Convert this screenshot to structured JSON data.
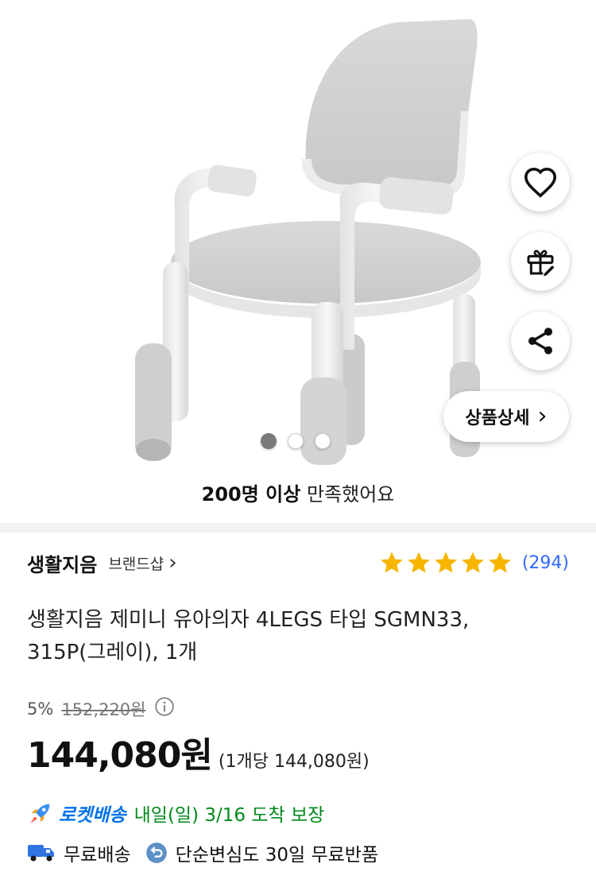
{
  "gallery": {
    "image_alt": "gray kids chair with four legs and armrests",
    "dots": 3,
    "active_dot": 0
  },
  "actions": {
    "like_icon": "heart-icon",
    "gift_icon": "gift-icon",
    "share_icon": "share-icon",
    "detail_label": "상품상세",
    "detail_chevron": "›"
  },
  "satisfaction": {
    "bold": "200명 이상",
    "rest": "만족했어요"
  },
  "brand": {
    "name": "생활지음",
    "shop_label": "브랜드샵",
    "chevron": "›"
  },
  "rating": {
    "stars": 5,
    "value": 5,
    "count": "(294)",
    "star_color": "#f7b500"
  },
  "product": {
    "title": "생활지음 제미니 유아의자 4LEGS 타입 SGMN33, 315P(그레이), 1개"
  },
  "price": {
    "discount": "5%",
    "original": "152,220원",
    "info_icon": "info-icon",
    "current": "144,080원",
    "unit_price": "(1개당 144,080원)"
  },
  "delivery": {
    "rocket_icon": "rocket-icon",
    "rocket_label": "로켓배송",
    "arrival": "내일(일) 3/16 도착 보장",
    "free_shipping_icon": "truck-icon",
    "free_shipping": "무료배송",
    "return_icon": "return-icon",
    "free_return": "단순변심도 30일 무료반품"
  },
  "colors": {
    "accent_blue": "#346aff",
    "rocket_blue": "#0073e9",
    "arrival_green": "#00891a"
  }
}
